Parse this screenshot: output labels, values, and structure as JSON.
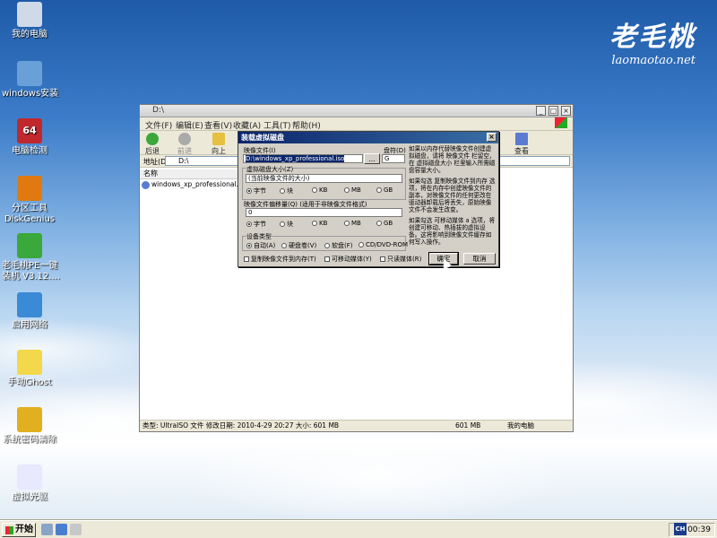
{
  "desktop": {
    "icons": [
      {
        "label": "我的电脑",
        "icon": "computer-icon",
        "color": "#cfd9e8"
      },
      {
        "label": "windows安装",
        "icon": "installer-icon",
        "color": "#6aa0d8"
      },
      {
        "label": "电脑检测",
        "icon": "cpu-64-icon",
        "color": "#c0282d",
        "badge": "64"
      },
      {
        "label": "分区工具\nDiskGenius",
        "icon": "diskgenius-icon",
        "color": "#e07a10"
      },
      {
        "label": "老毛桃PE一键\n装机 V3.12....",
        "icon": "recycle-icon",
        "color": "#3aa83a"
      },
      {
        "label": "启用网络",
        "icon": "network-icon",
        "color": "#3a8ad6"
      },
      {
        "label": "手动Ghost",
        "icon": "ghost-icon",
        "color": "#f2d84a"
      },
      {
        "label": "系统密码清除",
        "icon": "key-icon",
        "color": "#e0b020"
      },
      {
        "label": "虚拟光驱",
        "icon": "virtual-drive-icon",
        "color": "#e8e8ff"
      }
    ],
    "logo": {
      "main": "老毛桃",
      "site": "laomaotao.net"
    }
  },
  "explorer": {
    "title": "D:\\",
    "menu": [
      "文件(F)",
      "编辑(E)",
      "查看(V)",
      "收藏(A)",
      "工具(T)",
      "帮助(H)"
    ],
    "toolbar": {
      "back": "后退",
      "forward": "前进",
      "up": "向上",
      "view": "查看"
    },
    "address": {
      "label": "地址(D)",
      "value": "D:\\"
    },
    "column_name": "名称",
    "files": [
      "windows_xp_professional.iso"
    ],
    "status": {
      "info": "类型: UltraISO 文件 修改日期: 2010-4-29 20:27 大小: 601 MB",
      "size": "601 MB",
      "location": "我的电脑"
    }
  },
  "dialog": {
    "title": "装载虚拟磁盘",
    "image_file_label": "映像文件(I)",
    "image_file_value": "D:\\windows_xp_professional.iso",
    "browse": "...",
    "drive_label": "盘符(D)",
    "drive_value": "G",
    "disk_size_label": "虚拟磁盘大小(Z)",
    "disk_size_value": "(当前映像文件的大小)",
    "offset_label": "映像文件偏移量(Q) (适用于非映像文件格式)",
    "offset_value": "0",
    "units": [
      "字节",
      "块",
      "KB",
      "MB",
      "GB"
    ],
    "device_type_label": "设备类型",
    "device_types": [
      "自动(A)",
      "硬盘卷(V)",
      "软盘(F)",
      "CD/DVD-ROM"
    ],
    "options": [
      "复制映像文件到内存(T)",
      "可移动媒体(Y)",
      "只读媒体(R)"
    ],
    "ok": "确定",
    "cancel": "取消",
    "help": [
      "如果以内存代替映像文件创建虚拟磁盘，请将 映像文件 栏留空，在 虚拟磁盘大小 栏里输入所需磁盘容量大小。",
      "如果勾选 复制映像文件到内存 选项，将在内存中创建映像文件的副本，对映像文件的任何更改在驱动器卸载后将丢失，原始映像文件不会发生改变。",
      "如果勾选 可移动媒体 a 选项，将创建可移动、热插拔的虚拟设备。这将影响到映像文件缓存如何写入操作。"
    ]
  },
  "taskbar": {
    "start": "开始",
    "ime": "CH",
    "clock": "00:39"
  }
}
